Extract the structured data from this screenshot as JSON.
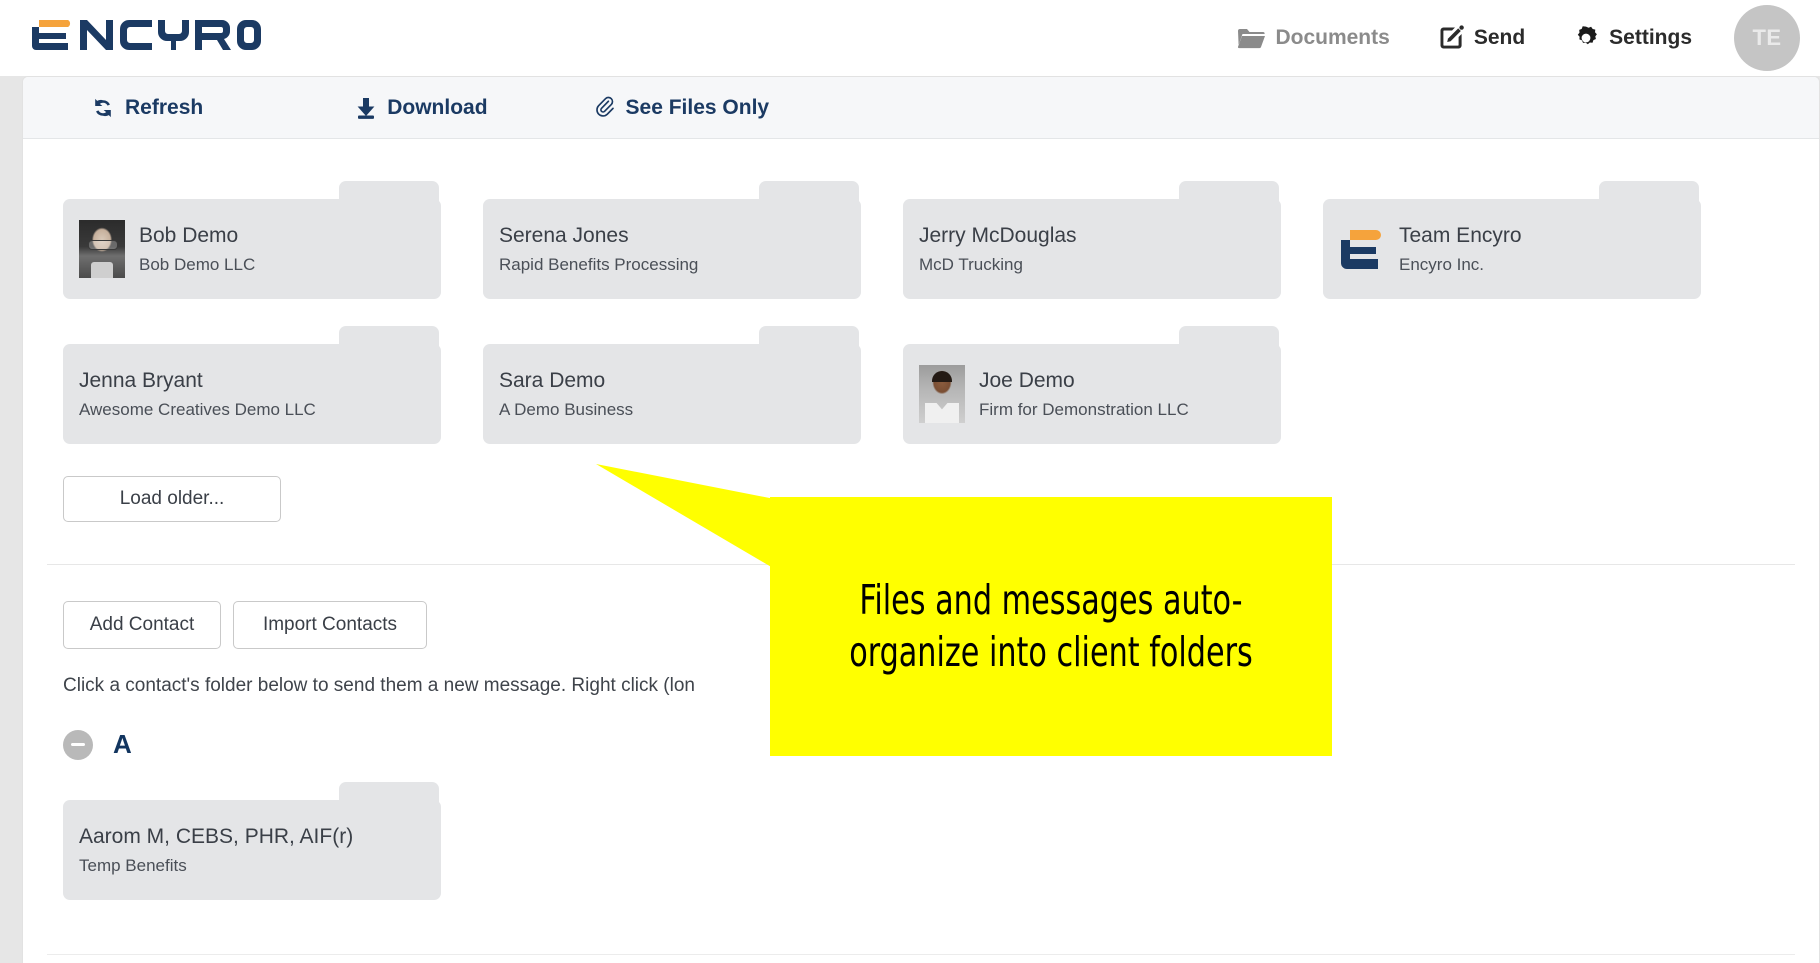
{
  "brand": {
    "name": "ENCYRO",
    "orange": "#F5A33C",
    "navy": "#1B3A63"
  },
  "header": {
    "nav": [
      {
        "label": "Documents",
        "icon": "folder-icon",
        "state": "muted"
      },
      {
        "label": "Send",
        "icon": "compose-icon",
        "state": "active"
      },
      {
        "label": "Settings",
        "icon": "gear-icon",
        "state": "active"
      }
    ],
    "avatar_initials": "TE"
  },
  "toolbar": {
    "items": [
      {
        "label": "Refresh",
        "icon": "refresh-icon"
      },
      {
        "label": "Download",
        "icon": "download-icon"
      },
      {
        "label": "See Files Only",
        "icon": "paperclip-icon"
      }
    ]
  },
  "recent_folders": [
    {
      "name": "Bob Demo",
      "org": "Bob Demo LLC",
      "avatar": "photo-bob"
    },
    {
      "name": "Serena Jones",
      "org": "Rapid Benefits Processing",
      "avatar": "none"
    },
    {
      "name": "Jerry McDouglas",
      "org": "McD Trucking",
      "avatar": "none"
    },
    {
      "name": "Team Encyro",
      "org": "Encyro Inc.",
      "avatar": "encyro-logo"
    },
    {
      "name": "Jenna Bryant",
      "org": "Awesome Creatives Demo LLC",
      "avatar": "none"
    },
    {
      "name": "Sara Demo",
      "org": "A Demo Business",
      "avatar": "none"
    },
    {
      "name": "Joe Demo",
      "org": "Firm for Demonstration LLC",
      "avatar": "photo-joe"
    }
  ],
  "load_older_label": "Load older...",
  "actions": {
    "add_contact": "Add Contact",
    "import_contacts": "Import Contacts"
  },
  "hint_text": "Click a contact's folder below to send them a new message. Right click (lon",
  "alpha_section": {
    "letter": "A",
    "collapse_icon": "minus-icon",
    "contacts": [
      {
        "name": "Aarom M, CEBS, PHR, AIF(r)",
        "org": "Temp Benefits",
        "avatar": "none"
      }
    ]
  },
  "callout": {
    "text": "Files and messages auto-organize into client folders",
    "color": "#FFFF00"
  }
}
